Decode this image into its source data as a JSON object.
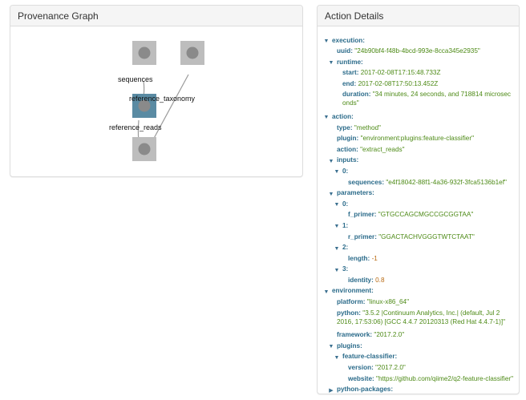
{
  "graph_panel": {
    "title": "Provenance Graph",
    "edge_labels": [
      "sequences",
      "reference_taxonomy",
      "reference_reads"
    ]
  },
  "details_panel": {
    "title": "Action Details",
    "execution": {
      "key": "execution:",
      "uuid_key": "uuid:",
      "uuid": "\"24b90bf4-f48b-4bcd-993e-8cca345e2935\"",
      "runtime_key": "runtime:",
      "start_key": "start:",
      "start": "2017-02-08T17:15:48.733Z",
      "end_key": "end:",
      "end": "2017-02-08T17:50:13.452Z",
      "duration_key": "duration:",
      "duration": "\"34 minutes, 24 seconds, and 718814 microseconds\""
    },
    "action": {
      "key": "action:",
      "type_key": "type:",
      "type": "\"method\"",
      "plugin_key": "plugin:",
      "plugin": "\"environment:plugins:feature-classifier\"",
      "action_key": "action:",
      "action": "\"extract_reads\"",
      "inputs_key": "inputs:",
      "inputs_0_key": "0:",
      "sequences_key": "sequences:",
      "sequences": "\"e4f18042-88f1-4a36-932f-3fca5136b1ef\"",
      "parameters_key": "parameters:",
      "p0_key": "0:",
      "f_primer_key": "f_primer:",
      "f_primer": "\"GTGCCAGCMGCCGCGGTAA\"",
      "p1_key": "1:",
      "r_primer_key": "r_primer:",
      "r_primer": "\"GGACTACHVGGGTWTCTAAT\"",
      "p2_key": "2:",
      "length_key": "length:",
      "length": "-1",
      "p3_key": "3:",
      "identity_key": "identity:",
      "identity": "0.8"
    },
    "environment": {
      "key": "environment:",
      "platform_key": "platform:",
      "platform": "\"linux-x86_64\"",
      "python_key": "python:",
      "python": "\"3.5.2 |Continuum Analytics, Inc.| (default, Jul 2 2016, 17:53:06) [GCC 4.4.7 20120313 (Red Hat 4.4.7-1)]\"",
      "framework_key": "framework:",
      "framework": "\"2017.2.0\"",
      "plugins_key": "plugins:",
      "fc_key": "feature-classifier:",
      "version_key": "version:",
      "version": "\"2017.2.0\"",
      "website_key": "website:",
      "website": "\"https://github.com/qiime2/q2-feature-classifier\"",
      "python_packages_key": "python-packages:"
    }
  },
  "icons": {
    "expanded": "▼",
    "collapsed": "▶"
  },
  "colors": {
    "key": "#2b6b8a",
    "string_value": "#4d8a16",
    "number_value": "#b86a12",
    "selected_node": "#5a8ba3",
    "node": "#bdbdbd"
  }
}
